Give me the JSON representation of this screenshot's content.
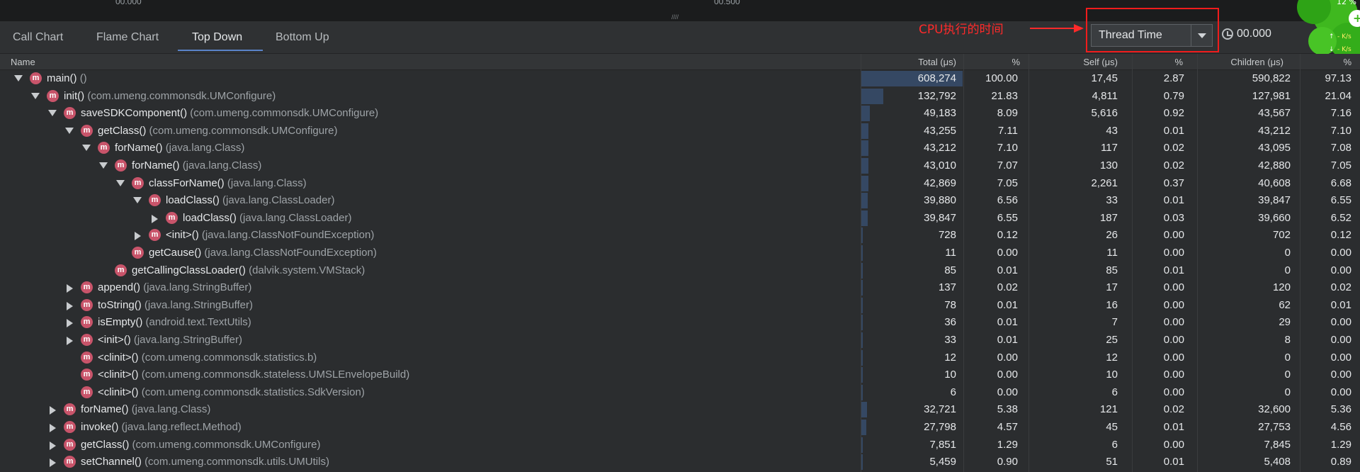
{
  "ruler": {
    "left": "00.000",
    "right": "00.500"
  },
  "tabs": [
    {
      "label": "Call Chart"
    },
    {
      "label": "Flame Chart"
    },
    {
      "label": "Top Down"
    },
    {
      "label": "Bottom Up"
    }
  ],
  "annotation": "CPU执行的时间",
  "clock_select": {
    "value": "Thread Time"
  },
  "time_readout": "00.000",
  "widget": {
    "pct": "12 %",
    "up": "- K/s",
    "down": "- K/s"
  },
  "columns": {
    "name": "Name",
    "total": "Total (μs)",
    "total_pct": "%",
    "self": "Self (μs)",
    "self_pct": "%",
    "children": "Children (μs)",
    "children_pct": "%"
  },
  "rows": [
    {
      "fn": "main()",
      "cls": "()",
      "total": "608,274",
      "tp": "100.00",
      "self": "17,45",
      "sp": "2.87",
      "children": "590,822",
      "cp": "97.13",
      "expand": "down"
    },
    {
      "fn": "init()",
      "cls": "(com.umeng.commonsdk.UMConfigure)",
      "total": "132,792",
      "tp": "21.83",
      "self": "4,811",
      "sp": "0.79",
      "children": "127,981",
      "cp": "21.04",
      "expand": "down"
    },
    {
      "fn": "saveSDKComponent()",
      "cls": "(com.umeng.commonsdk.UMConfigure)",
      "total": "49,183",
      "tp": "8.09",
      "self": "5,616",
      "sp": "0.92",
      "children": "43,567",
      "cp": "7.16",
      "expand": "down"
    },
    {
      "fn": "getClass()",
      "cls": "(com.umeng.commonsdk.UMConfigure)",
      "total": "43,255",
      "tp": "7.11",
      "self": "43",
      "sp": "0.01",
      "children": "43,212",
      "cp": "7.10",
      "expand": "down"
    },
    {
      "fn": "forName()",
      "cls": "(java.lang.Class)",
      "total": "43,212",
      "tp": "7.10",
      "self": "117",
      "sp": "0.02",
      "children": "43,095",
      "cp": "7.08",
      "expand": "down"
    },
    {
      "fn": "forName()",
      "cls": "(java.lang.Class)",
      "total": "43,010",
      "tp": "7.07",
      "self": "130",
      "sp": "0.02",
      "children": "42,880",
      "cp": "7.05",
      "expand": "down"
    },
    {
      "fn": "classForName()",
      "cls": "(java.lang.Class)",
      "total": "42,869",
      "tp": "7.05",
      "self": "2,261",
      "sp": "0.37",
      "children": "40,608",
      "cp": "6.68",
      "expand": "down"
    },
    {
      "fn": "loadClass()",
      "cls": "(java.lang.ClassLoader)",
      "total": "39,880",
      "tp": "6.56",
      "self": "33",
      "sp": "0.01",
      "children": "39,847",
      "cp": "6.55",
      "expand": "down"
    },
    {
      "fn": "loadClass()",
      "cls": "(java.lang.ClassLoader)",
      "total": "39,847",
      "tp": "6.55",
      "self": "187",
      "sp": "0.03",
      "children": "39,660",
      "cp": "6.52",
      "expand": "right"
    },
    {
      "fn": "<init>()",
      "cls": "(java.lang.ClassNotFoundException)",
      "total": "728",
      "tp": "0.12",
      "self": "26",
      "sp": "0.00",
      "children": "702",
      "cp": "0.12",
      "expand": "right"
    },
    {
      "fn": "getCause()",
      "cls": "(java.lang.ClassNotFoundException)",
      "total": "11",
      "tp": "0.00",
      "self": "11",
      "sp": "0.00",
      "children": "0",
      "cp": "0.00",
      "expand": "none"
    },
    {
      "fn": "getCallingClassLoader()",
      "cls": "(dalvik.system.VMStack)",
      "total": "85",
      "tp": "0.01",
      "self": "85",
      "sp": "0.01",
      "children": "0",
      "cp": "0.00",
      "expand": "none"
    },
    {
      "fn": "append()",
      "cls": "(java.lang.StringBuffer)",
      "total": "137",
      "tp": "0.02",
      "self": "17",
      "sp": "0.00",
      "children": "120",
      "cp": "0.02",
      "expand": "right"
    },
    {
      "fn": "toString()",
      "cls": "(java.lang.StringBuffer)",
      "total": "78",
      "tp": "0.01",
      "self": "16",
      "sp": "0.00",
      "children": "62",
      "cp": "0.01",
      "expand": "right"
    },
    {
      "fn": "isEmpty()",
      "cls": "(android.text.TextUtils)",
      "total": "36",
      "tp": "0.01",
      "self": "7",
      "sp": "0.00",
      "children": "29",
      "cp": "0.00",
      "expand": "right"
    },
    {
      "fn": "<init>()",
      "cls": "(java.lang.StringBuffer)",
      "total": "33",
      "tp": "0.01",
      "self": "25",
      "sp": "0.00",
      "children": "8",
      "cp": "0.00",
      "expand": "right"
    },
    {
      "fn": "<clinit>()",
      "cls": "(com.umeng.commonsdk.statistics.b)",
      "total": "12",
      "tp": "0.00",
      "self": "12",
      "sp": "0.00",
      "children": "0",
      "cp": "0.00",
      "expand": "none"
    },
    {
      "fn": "<clinit>()",
      "cls": "(com.umeng.commonsdk.stateless.UMSLEnvelopeBuild)",
      "total": "10",
      "tp": "0.00",
      "self": "10",
      "sp": "0.00",
      "children": "0",
      "cp": "0.00",
      "expand": "none"
    },
    {
      "fn": "<clinit>()",
      "cls": "(com.umeng.commonsdk.statistics.SdkVersion)",
      "total": "6",
      "tp": "0.00",
      "self": "6",
      "sp": "0.00",
      "children": "0",
      "cp": "0.00",
      "expand": "none"
    },
    {
      "fn": "forName()",
      "cls": "(java.lang.Class)",
      "total": "32,721",
      "tp": "5.38",
      "self": "121",
      "sp": "0.02",
      "children": "32,600",
      "cp": "5.36",
      "expand": "right"
    },
    {
      "fn": "invoke()",
      "cls": "(java.lang.reflect.Method)",
      "total": "27,798",
      "tp": "4.57",
      "self": "45",
      "sp": "0.01",
      "children": "27,753",
      "cp": "4.56",
      "expand": "right"
    },
    {
      "fn": "getClass()",
      "cls": "(com.umeng.commonsdk.UMConfigure)",
      "total": "7,851",
      "tp": "1.29",
      "self": "6",
      "sp": "0.00",
      "children": "7,845",
      "cp": "1.29",
      "expand": "right"
    },
    {
      "fn": "setChannel()",
      "cls": "(com.umeng.commonsdk.utils.UMUtils)",
      "total": "5,459",
      "tp": "0.90",
      "self": "51",
      "sp": "0.01",
      "children": "5,408",
      "cp": "0.89",
      "expand": "right"
    }
  ],
  "colors": {
    "accent": "#5a83c8",
    "annotation": "#ff2a2a",
    "method_icon": "#c8546a"
  }
}
